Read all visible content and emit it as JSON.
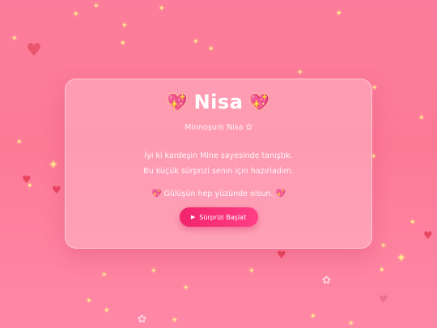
{
  "card": {
    "title_left_icon": "💖",
    "title": "Nisa",
    "title_right_icon": "💖",
    "subtitle": "Minnoşum Nisa",
    "subtitle_icon": "✿",
    "message_line1": "İyi ki kardeşin Mine sayesinde tanıştık.",
    "message_line2": "Bu küçük sürprizi senin için hazırladım.",
    "wish_left_icon": "💖",
    "wish": "Gülüşün hep yüzünde olsun.",
    "wish_right_icon": "💖",
    "button_icon": "▶",
    "button_label": "Sürprizi Başlat"
  },
  "decor": {
    "sparkle_glyph": "✦",
    "heart_glyph": "♥",
    "blossom_glyph": "✿"
  },
  "colors": {
    "background_top": "#fb7d9b",
    "background_bottom": "#fe88a6",
    "button": "#f1246c",
    "sparkle": "#ffe98a",
    "heart": "#e63c55"
  }
}
